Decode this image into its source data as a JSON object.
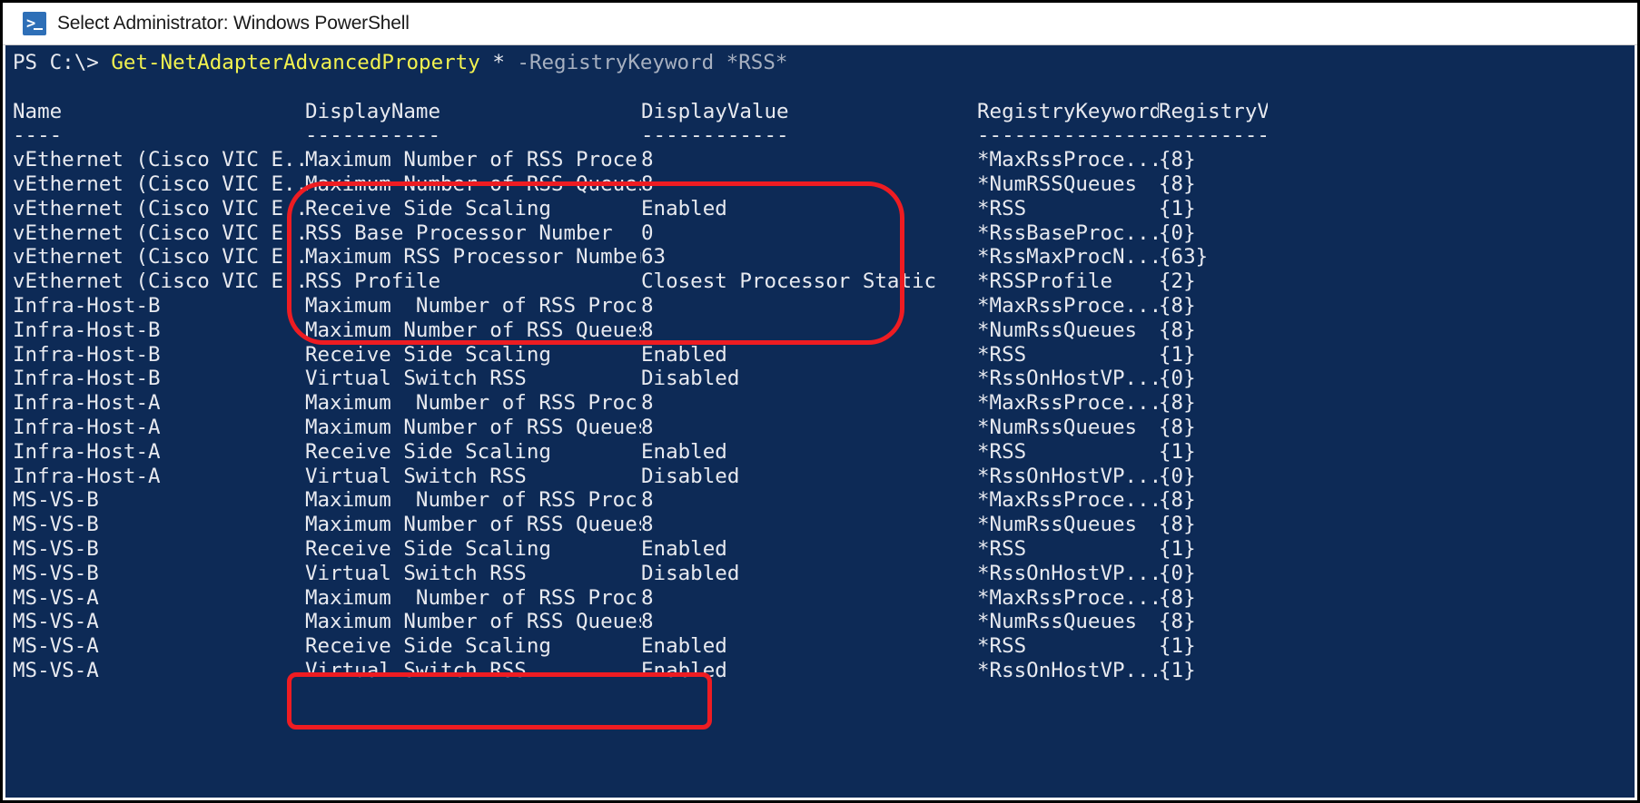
{
  "window": {
    "title": "Select Administrator: Windows PowerShell",
    "icon": "powershell-icon",
    "border_color": "#000000"
  },
  "console": {
    "background": "#0d2a56",
    "foreground": "#e8eaf0",
    "command_color": "#f2f24f",
    "parameter_color": "#a7b0c0",
    "prompt": "PS C:\\>",
    "command": "Get-NetAdapterAdvancedProperty",
    "command_star": "*",
    "command_param": "-RegistryKeyword",
    "command_param_value": "*RSS*"
  },
  "table": {
    "headers": {
      "name": "Name",
      "display_name": "DisplayName",
      "display_value": "DisplayValue",
      "registry_keyword": "RegistryKeyword",
      "registry_value": "RegistryValue"
    },
    "rules": {
      "name": "----",
      "display_name": "-----------",
      "display_value": "------------",
      "registry_keyword": "---------------",
      "registry_value": "-------------"
    },
    "rows": [
      {
        "name": "vEthernet (Cisco VIC E...",
        "display_name": "Maximum Number of RSS Proce...",
        "display_value": "8",
        "registry_keyword": "*MaxRssProce...",
        "registry_value": "{8}"
      },
      {
        "name": "vEthernet (Cisco VIC E...",
        "display_name": "Maximum Number of RSS Queues",
        "display_value": "8",
        "registry_keyword": "*NumRSSQueues",
        "registry_value": "{8}"
      },
      {
        "name": "vEthernet (Cisco VIC E...",
        "display_name": "Receive Side Scaling",
        "display_value": "Enabled",
        "registry_keyword": "*RSS",
        "registry_value": "{1}"
      },
      {
        "name": "vEthernet (Cisco VIC E...",
        "display_name": "RSS Base Processor Number",
        "display_value": "0",
        "registry_keyword": "*RssBaseProc...",
        "registry_value": "{0}"
      },
      {
        "name": "vEthernet (Cisco VIC E...",
        "display_name": "Maximum RSS Processor Number",
        "display_value": "63",
        "registry_keyword": "*RssMaxProcN...",
        "registry_value": "{63}"
      },
      {
        "name": "vEthernet (Cisco VIC E...",
        "display_name": "RSS Profile",
        "display_value": "Closest Processor Static",
        "registry_keyword": "*RSSProfile",
        "registry_value": "{2}"
      },
      {
        "name": "Infra-Host-B",
        "display_name": "Maximum  Number of RSS Proc...",
        "display_value": "8",
        "registry_keyword": "*MaxRssProce...",
        "registry_value": "{8}"
      },
      {
        "name": "Infra-Host-B",
        "display_name": "Maximum Number of RSS Queues",
        "display_value": "8",
        "registry_keyword": "*NumRssQueues",
        "registry_value": "{8}"
      },
      {
        "name": "Infra-Host-B",
        "display_name": "Receive Side Scaling",
        "display_value": "Enabled",
        "registry_keyword": "*RSS",
        "registry_value": "{1}"
      },
      {
        "name": "Infra-Host-B",
        "display_name": "Virtual Switch RSS",
        "display_value": "Disabled",
        "registry_keyword": "*RssOnHostVP...",
        "registry_value": "{0}"
      },
      {
        "name": "Infra-Host-A",
        "display_name": "Maximum  Number of RSS Proc...",
        "display_value": "8",
        "registry_keyword": "*MaxRssProce...",
        "registry_value": "{8}"
      },
      {
        "name": "Infra-Host-A",
        "display_name": "Maximum Number of RSS Queues",
        "display_value": "8",
        "registry_keyword": "*NumRssQueues",
        "registry_value": "{8}"
      },
      {
        "name": "Infra-Host-A",
        "display_name": "Receive Side Scaling",
        "display_value": "Enabled",
        "registry_keyword": "*RSS",
        "registry_value": "{1}"
      },
      {
        "name": "Infra-Host-A",
        "display_name": "Virtual Switch RSS",
        "display_value": "Disabled",
        "registry_keyword": "*RssOnHostVP...",
        "registry_value": "{0}"
      },
      {
        "name": "MS-VS-B",
        "display_name": "Maximum  Number of RSS Proc...",
        "display_value": "8",
        "registry_keyword": "*MaxRssProce...",
        "registry_value": "{8}"
      },
      {
        "name": "MS-VS-B",
        "display_name": "Maximum Number of RSS Queues",
        "display_value": "8",
        "registry_keyword": "*NumRssQueues",
        "registry_value": "{8}"
      },
      {
        "name": "MS-VS-B",
        "display_name": "Receive Side Scaling",
        "display_value": "Enabled",
        "registry_keyword": "*RSS",
        "registry_value": "{1}"
      },
      {
        "name": "MS-VS-B",
        "display_name": "Virtual Switch RSS",
        "display_value": "Disabled",
        "registry_keyword": "*RssOnHostVP...",
        "registry_value": "{0}"
      },
      {
        "name": "MS-VS-A",
        "display_name": "Maximum  Number of RSS Proc...",
        "display_value": "8",
        "registry_keyword": "*MaxRssProce...",
        "registry_value": "{8}"
      },
      {
        "name": "MS-VS-A",
        "display_name": "Maximum Number of RSS Queues",
        "display_value": "8",
        "registry_keyword": "*NumRssQueues",
        "registry_value": "{8}"
      },
      {
        "name": "MS-VS-A",
        "display_name": "Receive Side Scaling",
        "display_value": "Enabled",
        "registry_keyword": "*RSS",
        "registry_value": "{1}"
      },
      {
        "name": "MS-VS-A",
        "display_name": "Virtual Switch RSS",
        "display_value": "Enabled",
        "registry_keyword": "*RssOnHostVP...",
        "registry_value": "{1}"
      }
    ]
  },
  "annotations": {
    "color": "#ee1c22",
    "boxes": [
      {
        "id": "vethernet-rss-settings-highlight",
        "rows": "1-6"
      },
      {
        "id": "ms-vs-a-rss-highlight",
        "rows": "21-22"
      }
    ]
  }
}
